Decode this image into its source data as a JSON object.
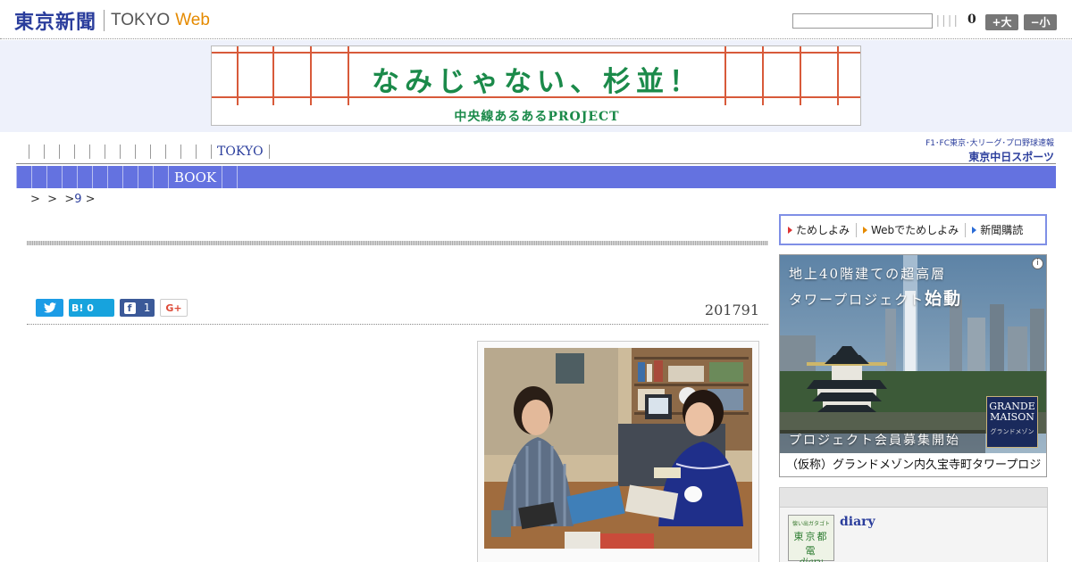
{
  "header": {
    "logo_jp": "東京新聞",
    "logo_en": "TOKYO",
    "logo_web": "Web",
    "search_placeholder": "",
    "count": "0",
    "size_up_label": "+大",
    "size_down_label": "−小"
  },
  "banner": {
    "title": "なみじゃない、杉並！",
    "subtitle": "中央線あるあるPROJECT"
  },
  "nav_primary": {
    "label": "TOKYO"
  },
  "nav_secondary": {
    "label": "BOOK"
  },
  "chunichi": {
    "top": "F1･FC東京･大リーグ･プロ野球速報",
    "bottom": "東京中日スポーツ"
  },
  "breadcrumb": {
    "sep1": ">",
    "sep2": ">",
    "sep3": ">",
    "num": "9",
    "sep4": ">"
  },
  "social": {
    "hatena_label": "B!",
    "hatena_count": "0",
    "facebook_count": "1",
    "gplus_label": "G+"
  },
  "article": {
    "date": "201791"
  },
  "subscribe": {
    "item1": "ためしよみ",
    "item2": "Webでためしよみ",
    "item3": "新聞購読"
  },
  "ad": {
    "line1": "地上40階建ての超高層",
    "line2_pre": "タワープロジェクト",
    "line2_em": "始動",
    "brand_en": "GRANDE MAISON",
    "brand_jp": "グランドメゾン",
    "member": "プロジェクト会員募集開始",
    "footer": "（仮称）グランドメゾン内久宝寺町タワープロジェクト"
  },
  "diary": {
    "thumb_top": "懐い出ガタゴト",
    "thumb_mid": "東京都電",
    "thumb_bottom": "diary",
    "title": "diary"
  },
  "colors": {
    "brand_blue": "#2a3d9c",
    "nav_blue": "#6472e0",
    "web_orange": "#e58a00",
    "banner_green": "#1b8a4a",
    "banner_red": "#d85a3a"
  }
}
